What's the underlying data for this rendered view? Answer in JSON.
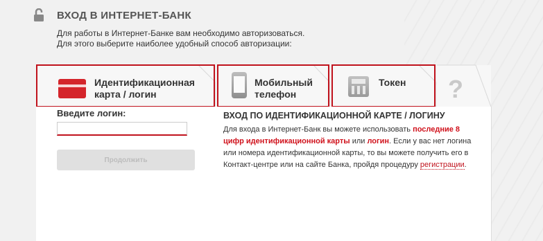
{
  "header": {
    "title": "ВХОД В ИНТЕРНЕТ-БАНК",
    "intro_line1": "Для работы в Интернет-Банке вам необходимо авторизоваться.",
    "intro_line2": "Для этого выберите наиболее удобный способ авторизации:"
  },
  "tabs": [
    {
      "line1": "Идентификационная",
      "line2": "карта / логин",
      "icon": "card-icon"
    },
    {
      "line1": "Мобильный",
      "line2": "телефон",
      "icon": "phone-icon"
    },
    {
      "line1": "Токен",
      "icon": "token-icon"
    },
    {
      "icon": "help-icon",
      "glyph": "?"
    }
  ],
  "login": {
    "label": "Введите логин:",
    "value": "",
    "button": "Продолжить"
  },
  "info": {
    "title": "ВХОД ПО ИДЕНТИФИКАЦИОННОЙ КАРТЕ / ЛОГИНУ",
    "text_a": "Для входа в Интернет-Банк вы можете использовать ",
    "highlight_a": "последние 8 цифр идентификационной карты",
    "text_b": " или ",
    "highlight_b": "логин",
    "text_c": ". Если у вас нет логина или номера идентификационной карты, то вы можете получить его в Контакт-центре или на сайте Банка, пройдя процедуру ",
    "link": "регистрации",
    "text_d": "."
  },
  "colors": {
    "accent": "#c0121c",
    "text": "#333333",
    "muted": "#555555"
  }
}
